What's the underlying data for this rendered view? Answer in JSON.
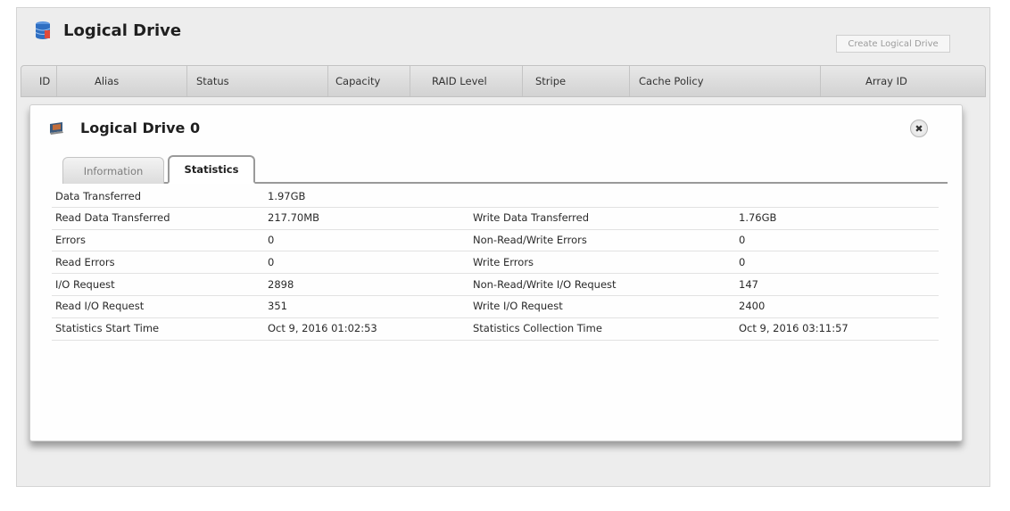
{
  "page": {
    "title": "Logical Drive",
    "create_button": "Create Logical Drive"
  },
  "table": {
    "columns": [
      "ID",
      "Alias",
      "Status",
      "Capacity",
      "RAID Level",
      "Stripe",
      "Cache Policy",
      "Array ID"
    ]
  },
  "dialog": {
    "title": "Logical Drive 0",
    "close_glyph": "✖",
    "tabs": [
      {
        "label": "Information",
        "active": false
      },
      {
        "label": "Statistics",
        "active": true
      }
    ],
    "rows": [
      [
        "Data Transferred",
        "1.97GB",
        "",
        ""
      ],
      [
        "Read Data Transferred",
        "217.70MB",
        "Write Data Transferred",
        "1.76GB"
      ],
      [
        "Errors",
        "0",
        "Non-Read/Write Errors",
        "0"
      ],
      [
        "Read Errors",
        "0",
        "Write Errors",
        "0"
      ],
      [
        "I/O Request",
        "2898",
        "Non-Read/Write I/O Request",
        "147"
      ],
      [
        "Read I/O Request",
        "351",
        "Write I/O Request",
        "2400"
      ],
      [
        "Statistics Start Time",
        "Oct 9, 2016 01:02:53",
        "Statistics Collection Time",
        "Oct 9, 2016 03:11:57"
      ]
    ]
  },
  "icons": {
    "page": "database-icon",
    "dialog": "logical-drive-icon",
    "close": "close-icon"
  },
  "colors": {
    "database_icon": "#2f6fc2",
    "tab_border": "#9a9a9a"
  }
}
